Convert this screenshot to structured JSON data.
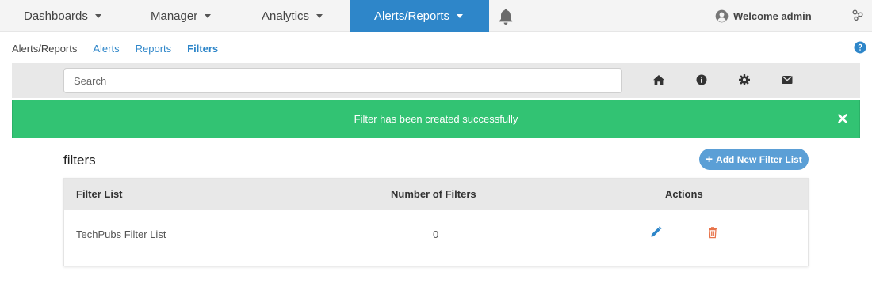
{
  "nav": {
    "items": [
      {
        "label": "Dashboards"
      },
      {
        "label": "Manager"
      },
      {
        "label": "Analytics"
      },
      {
        "label": "Alerts/Reports"
      }
    ],
    "welcome": "Welcome admin"
  },
  "breadcrumb": {
    "items": [
      {
        "label": "Alerts/Reports"
      },
      {
        "label": "Alerts"
      },
      {
        "label": "Reports"
      },
      {
        "label": "Filters"
      }
    ]
  },
  "search": {
    "placeholder": "Search",
    "value": ""
  },
  "toolbar_icons": [
    "home-icon",
    "info-icon",
    "gear-icon",
    "envelope-icon"
  ],
  "alert": {
    "message": "Filter has been created successfully",
    "color": "#32c373"
  },
  "section": {
    "title": "filters",
    "add_button": "Add New Filter List"
  },
  "table": {
    "headers": {
      "name": "Filter List",
      "count": "Number of Filters",
      "actions": "Actions"
    },
    "rows": [
      {
        "name": "TechPubs Filter List",
        "count": "0"
      }
    ]
  },
  "colors": {
    "accent": "#2e86c9",
    "button": "#5b9fd6",
    "delete": "#e8734a"
  }
}
